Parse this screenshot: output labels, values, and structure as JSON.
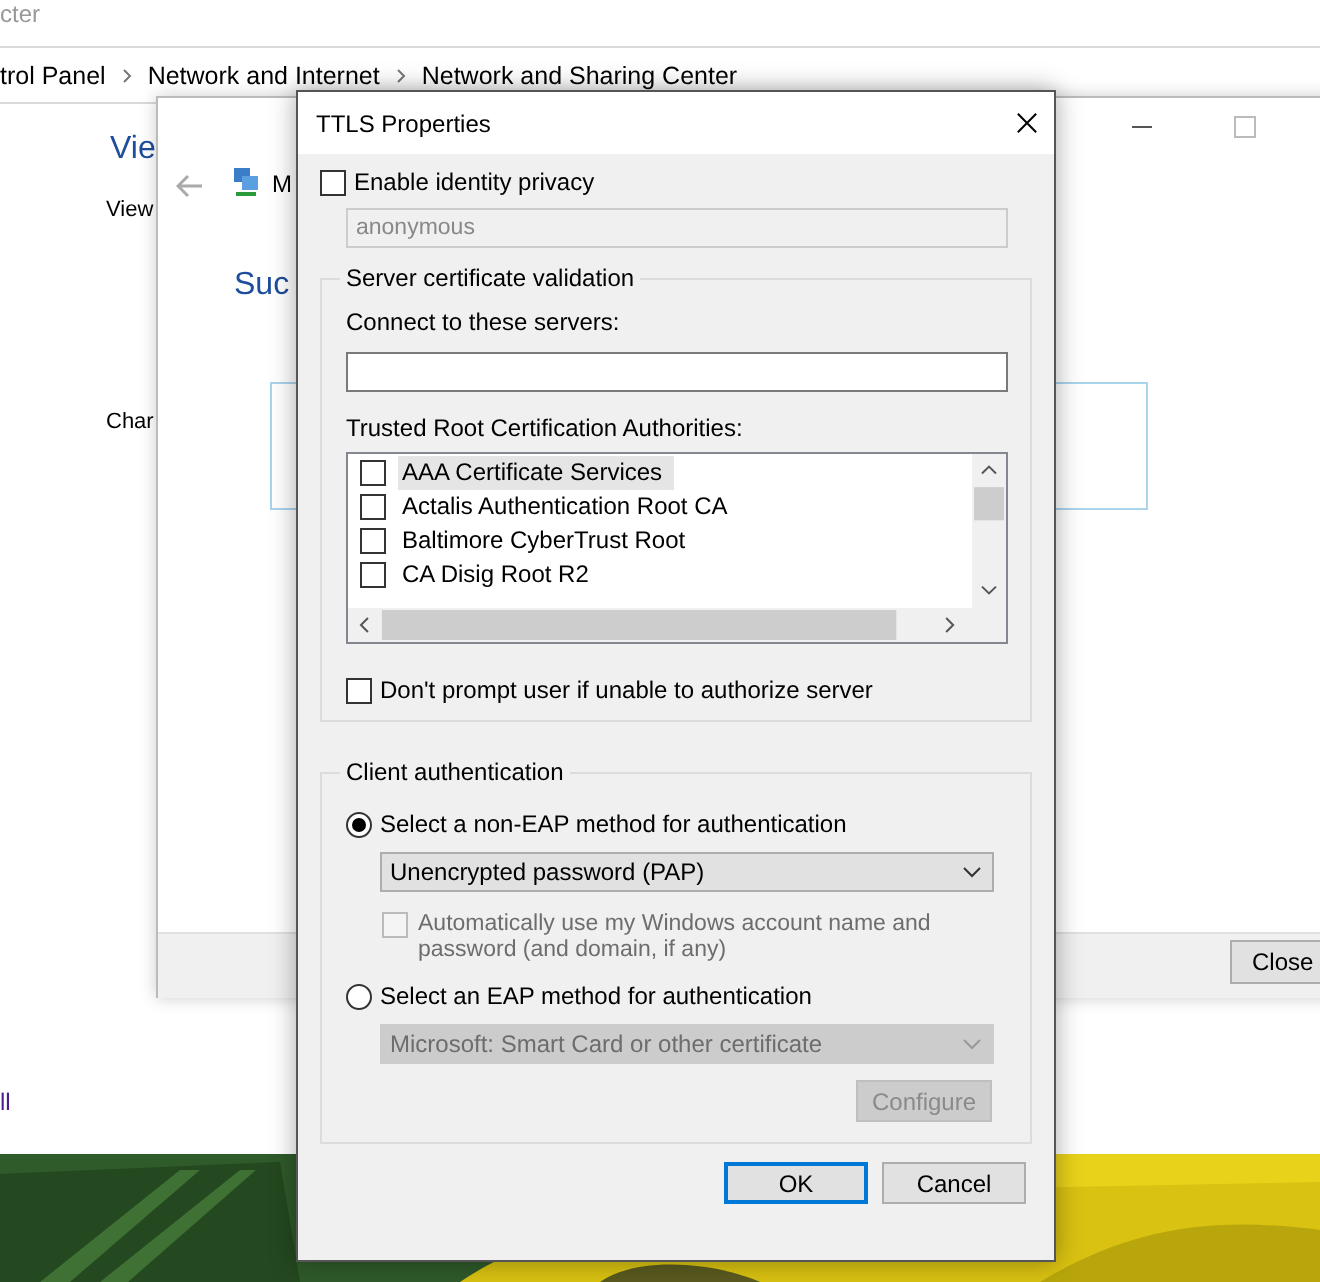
{
  "explorer": {
    "title": "cter",
    "breadcrumb": [
      "trol Panel",
      "Network and Internet",
      "Network and Sharing Center"
    ],
    "heading": "Vie",
    "text_1": "View",
    "text_2": "Char",
    "link": "ll"
  },
  "wizard": {
    "title": "M",
    "heading": "Suc",
    "close_button": "Close"
  },
  "dialog": {
    "title": "TTLS Properties",
    "identity_privacy": {
      "label": "Enable identity privacy",
      "checked": false,
      "value": "anonymous",
      "disabled": true
    },
    "server_validation": {
      "title": "Server certificate validation",
      "servers_label": "Connect to these servers:",
      "authorities_label": "Trusted Root Certification Authorities:",
      "authorities": [
        {
          "label": "AAA Certificate Services",
          "checked": false,
          "selected": true
        },
        {
          "label": "Actalis Authentication Root CA",
          "checked": false,
          "selected": false
        },
        {
          "label": "Baltimore CyberTrust Root",
          "checked": false,
          "selected": false
        },
        {
          "label": "CA Disig Root R2",
          "checked": false,
          "selected": false
        }
      ],
      "dont_prompt": {
        "label": "Don't prompt user if unable to authorize server",
        "checked": false
      }
    },
    "client_auth": {
      "title": "Client authentication",
      "options": [
        {
          "label": "Select a non-EAP method for authentication",
          "selected": true,
          "dropdown": {
            "value": "Unencrypted password (PAP)",
            "disabled": false
          },
          "auto_use": {
            "label": "Automatically use my Windows account name and password (and domain, if any)",
            "checked": false,
            "disabled": true
          }
        },
        {
          "label": "Select an EAP method for authentication",
          "selected": false,
          "dropdown": {
            "value": "Microsoft: Smart Card or other certificate",
            "disabled": true
          },
          "configure": {
            "label": "Configure",
            "disabled": true
          }
        }
      ]
    },
    "buttons": [
      {
        "label": "OK",
        "default": true
      },
      {
        "label": "Cancel",
        "default": false
      }
    ]
  }
}
